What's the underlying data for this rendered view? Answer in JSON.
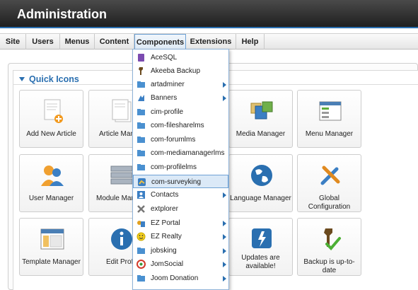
{
  "header": {
    "title": "Administration"
  },
  "menu": [
    {
      "label": "Site"
    },
    {
      "label": "Users"
    },
    {
      "label": "Menus"
    },
    {
      "label": "Content"
    },
    {
      "label": "Components"
    },
    {
      "label": "Extensions"
    },
    {
      "label": "Help"
    }
  ],
  "quick_icons": {
    "heading": "Quick Icons",
    "tiles": [
      {
        "label": "Add New Article",
        "icon": "add-article-icon"
      },
      {
        "label": "Article Mana",
        "icon": "article-manager-icon"
      },
      {
        "label": "Media Manager",
        "icon": "media-manager-icon"
      },
      {
        "label": "Menu Manager",
        "icon": "menu-manager-icon"
      },
      {
        "label": "User Manager",
        "icon": "user-manager-icon"
      },
      {
        "label": "Module Mana",
        "icon": "module-manager-icon"
      },
      {
        "label": "Language Manager",
        "icon": "globe-icon"
      },
      {
        "label": "Global Configuration",
        "icon": "tools-icon"
      },
      {
        "label": "Template Manager",
        "icon": "template-manager-icon"
      },
      {
        "label": "Edit Profil",
        "icon": "info-icon"
      },
      {
        "label": "Updates are available!",
        "icon": "update-icon"
      },
      {
        "label": "Backup is up-to-date",
        "icon": "backup-icon"
      }
    ]
  },
  "components_dropdown": [
    {
      "label": "AceSQL",
      "icon": "acesql-icon",
      "submenu": false
    },
    {
      "label": "Akeeba Backup",
      "icon": "akeeba-icon",
      "submenu": false
    },
    {
      "label": "artadminer",
      "icon": "component-icon",
      "submenu": true
    },
    {
      "label": "Banners",
      "icon": "banners-icon",
      "submenu": true
    },
    {
      "label": "cim-profile",
      "icon": "component-icon",
      "submenu": false
    },
    {
      "label": "com-filesharelms",
      "icon": "component-icon",
      "submenu": false
    },
    {
      "label": "com-forumlms",
      "icon": "component-icon",
      "submenu": false
    },
    {
      "label": "com-mediamanagerlms",
      "icon": "component-icon",
      "submenu": false
    },
    {
      "label": "com-profilelms",
      "icon": "component-icon",
      "submenu": false
    },
    {
      "label": "com-surveyking",
      "icon": "surveyking-icon",
      "submenu": false,
      "highlighted": true
    },
    {
      "label": "Contacts",
      "icon": "contacts-icon",
      "submenu": true
    },
    {
      "label": "extplorer",
      "icon": "extplorer-icon",
      "submenu": false
    },
    {
      "label": "EZ Portal",
      "icon": "ez-portal-icon",
      "submenu": true
    },
    {
      "label": "EZ Realty",
      "icon": "ez-realty-icon",
      "submenu": true
    },
    {
      "label": "jobsking",
      "icon": "component-icon",
      "submenu": true
    },
    {
      "label": "JomSocial",
      "icon": "jomsocial-icon",
      "submenu": true
    },
    {
      "label": "Joom Donation",
      "icon": "component-icon",
      "submenu": true
    }
  ],
  "colors": {
    "accent": "#2a6fb0",
    "header_bg": "#2b2b2b",
    "highlight": "#dbe9f7"
  }
}
